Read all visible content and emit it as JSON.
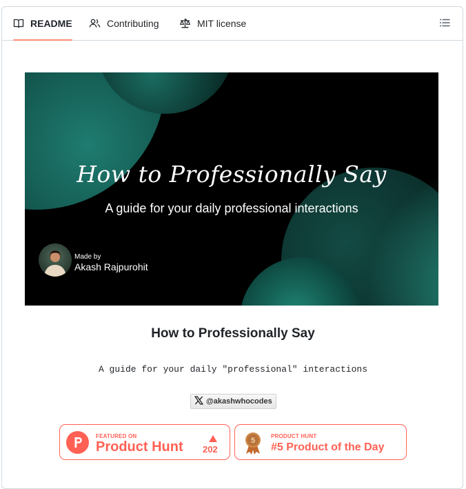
{
  "tabs": [
    {
      "label": "README",
      "icon": "book-icon",
      "active": true
    },
    {
      "label": "Contributing",
      "icon": "people-icon",
      "active": false
    },
    {
      "label": "MIT license",
      "icon": "scale-icon",
      "active": false
    }
  ],
  "toc_icon": "list-icon",
  "banner": {
    "title": "How to Professionally Say",
    "subtitle": "A guide for your daily professional interactions",
    "made_by": "Made by",
    "author": "Akash Rajpurohit"
  },
  "readme": {
    "heading": "How to Professionally Say",
    "tagline": "A guide for your daily \"professional\" interactions"
  },
  "twitter_badge": {
    "icon": "x-logo-icon",
    "label": "@akashwhocodes"
  },
  "product_hunt": {
    "featured": {
      "small": "FEATURED ON",
      "big": "Product Hunt",
      "votes": "202"
    },
    "day": {
      "small": "PRODUCT HUNT",
      "big": "#5 Product of the Day",
      "rank": "5"
    }
  },
  "colors": {
    "accent": "#fd8c73",
    "product_hunt": "#ff6154",
    "border": "#d1d9e0"
  }
}
